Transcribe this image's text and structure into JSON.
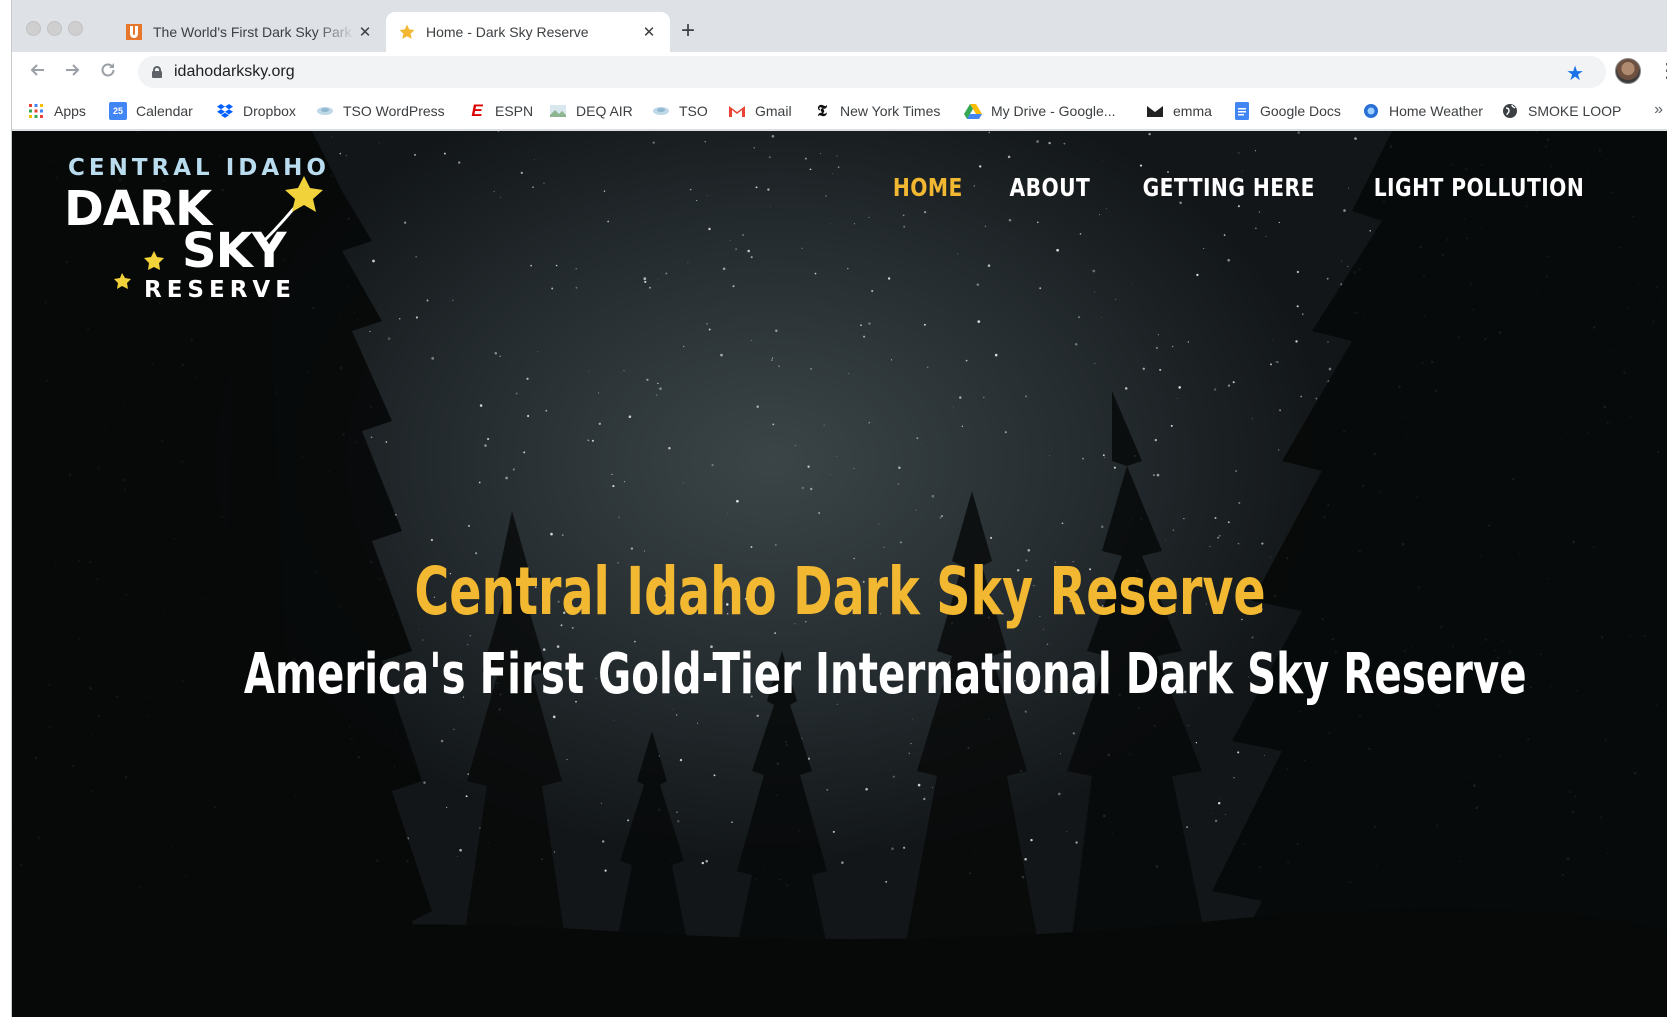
{
  "browser": {
    "tabs": [
      {
        "title": "The World's First Dark Sky Park",
        "favicon": "orange-u-icon",
        "active": false
      },
      {
        "title": "Home - Dark Sky Reserve",
        "favicon": "star-icon",
        "active": true
      }
    ],
    "new_tab_label": "+",
    "close_label": "✕",
    "url": "idahodarksky.org",
    "bookmarks": [
      {
        "label": "Apps",
        "icon": "apps-grid-icon"
      },
      {
        "label": "Calendar",
        "icon": "calendar-icon"
      },
      {
        "label": "Dropbox",
        "icon": "dropbox-icon"
      },
      {
        "label": "TSO WordPress",
        "icon": "tso-icon"
      },
      {
        "label": "ESPN",
        "icon": "espn-icon"
      },
      {
        "label": "DEQ AIR",
        "icon": "deq-icon"
      },
      {
        "label": "TSO",
        "icon": "tso-icon"
      },
      {
        "label": "Gmail",
        "icon": "gmail-icon"
      },
      {
        "label": "New York Times",
        "icon": "nyt-icon"
      },
      {
        "label": "My Drive - Google...",
        "icon": "google-drive-icon"
      },
      {
        "label": "emma",
        "icon": "emma-icon"
      },
      {
        "label": "Google Docs",
        "icon": "google-docs-icon"
      },
      {
        "label": "Home Weather",
        "icon": "weather-icon"
      },
      {
        "label": "SMOKE LOOP",
        "icon": "globe-icon"
      }
    ],
    "more_label": "»",
    "colors": {
      "accent": "#1a73e8",
      "tab_strip": "#dee1e6"
    }
  },
  "site": {
    "logo": {
      "line1": "CENTRAL IDAHO",
      "line2": "DARK",
      "line3": "SKY",
      "line4": "RESERVE"
    },
    "nav": [
      {
        "label": "HOME",
        "current": true
      },
      {
        "label": "ABOUT",
        "current": false
      },
      {
        "label": "GETTING HERE",
        "current": false
      },
      {
        "label": "LIGHT POLLUTION",
        "current": false
      }
    ],
    "hero": {
      "title": "Central Idaho Dark Sky Reserve",
      "subtitle": "America's First Gold-Tier International Dark Sky Reserve"
    },
    "colors": {
      "gold": "#f2b831",
      "logo_blue": "#b9dcef",
      "text": "#ffffff"
    }
  }
}
